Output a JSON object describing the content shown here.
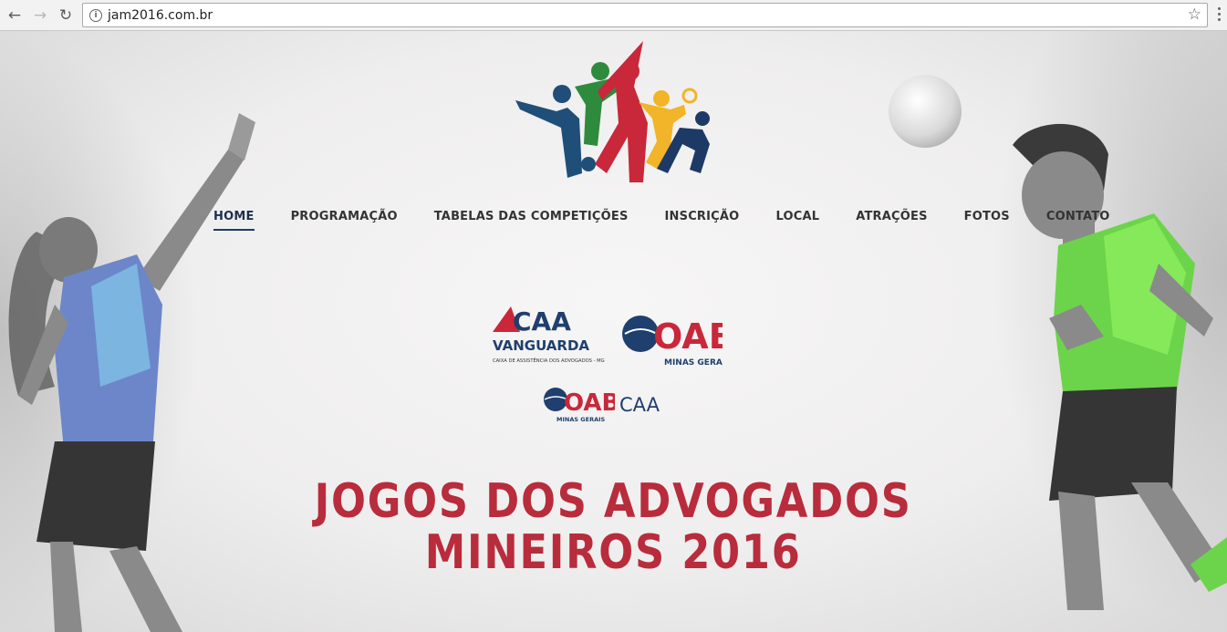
{
  "browser": {
    "url": "jam2016.com.br",
    "icons": [
      "back-icon",
      "forward-icon",
      "reload-icon",
      "info-icon",
      "star-icon",
      "menu-icon"
    ]
  },
  "nav": {
    "items": [
      {
        "label": "HOME",
        "active": true
      },
      {
        "label": "PROGRAMAÇÃO",
        "active": false
      },
      {
        "label": "TABELAS DAS COMPETIÇÕES",
        "active": false
      },
      {
        "label": "INSCRIÇÃO",
        "active": false
      },
      {
        "label": "LOCAL",
        "active": false
      },
      {
        "label": "ATRAÇÕES",
        "active": false
      },
      {
        "label": "FOTOS",
        "active": false
      },
      {
        "label": "CONTATO",
        "active": false
      }
    ]
  },
  "sponsors": {
    "caa_logo_text": "CAA",
    "caa_logo_sub": "VANGUARDA",
    "caa_logo_caption": "CAIXA DE ASSISTÊNCIA DOS ADVOGADOS - MG",
    "oab_text": "OAB",
    "oab_sub": "MINAS GERAIS",
    "oab_caa_text": "CAA"
  },
  "hero": {
    "line1": "JOGOS DOS ADVOGADOS",
    "line2": "MINEIROS 2016"
  },
  "colors": {
    "headline": "#b82c3c",
    "nav_active_underline": "#1d3a66",
    "logo_blue": "#1f4e79",
    "logo_green": "#2e8b3e",
    "logo_red": "#c8283a",
    "logo_yellow": "#f2b428"
  }
}
